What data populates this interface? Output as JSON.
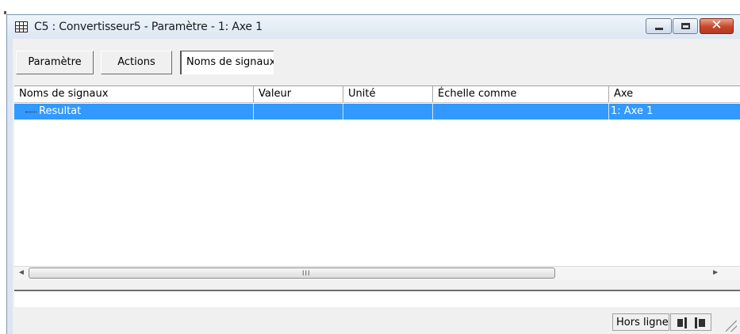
{
  "window": {
    "title": "C5 : Convertisseur5 - Paramètre - 1: Axe 1",
    "close_glyph": "✕"
  },
  "toolbar": {
    "tab1_label": "Paramètre",
    "tab2_label": "Actions",
    "tab3_value": "Noms de signaux"
  },
  "table": {
    "columns": [
      "Noms de signaux",
      "Valeur",
      "Unité",
      "Échelle comme",
      "Axe"
    ],
    "rows": [
      {
        "name": "Resultat",
        "valeur": "",
        "unite": "",
        "echelle": "",
        "axe": "1: Axe 1"
      }
    ],
    "selected_color": "#3399ff"
  },
  "scrollbar": {
    "left_arrow": "◄",
    "right_arrow": "►",
    "grip": "III"
  },
  "status": {
    "text": "Hors ligne",
    "icon": "plug-icon"
  }
}
